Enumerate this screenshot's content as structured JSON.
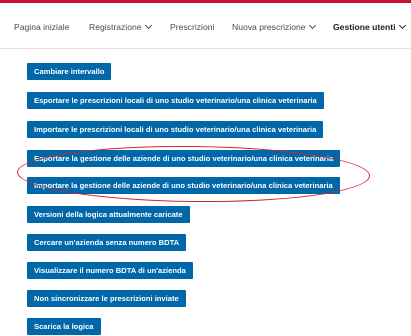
{
  "brand": {
    "accent": "#c8102e",
    "button_color": "#0067a8",
    "highlight_color": "#d2232a"
  },
  "nav": {
    "items": [
      {
        "label": "Pagina iniziale"
      },
      {
        "label": "Registrazione",
        "icon": "chevron-down-icon"
      },
      {
        "label": "Prescrizioni"
      },
      {
        "label": "Nuova prescrizione",
        "icon": "chevron-down-icon"
      },
      {
        "label": "Gestione utenti",
        "icon": "chevron-down-icon",
        "active": true
      }
    ]
  },
  "actions": [
    {
      "label": "Cambiare intervallo"
    },
    {
      "label": "Esportare le prescrizioni locali di uno studio veterinario/una clinica veterinaria"
    },
    {
      "label": "Importare le prescrizioni locali di uno studio veterinario/una clinica veterinaria"
    },
    {
      "label": "Esportare la gestione delle aziende di uno studio veterinario/una clinica veterinaria"
    },
    {
      "label": "Importare la gestione delle aziende di uno studio veterinario/una clinica veterinaria"
    },
    {
      "label": "Versioni della logica attualmente caricate"
    },
    {
      "label": "Cercare un'azienda senza numero BDTA"
    },
    {
      "label": "Visualizzare il numero BDTA di un'azienda"
    },
    {
      "label": "Non sincronizzare le prescrizioni inviate"
    },
    {
      "label": "Scarica la logica"
    }
  ]
}
